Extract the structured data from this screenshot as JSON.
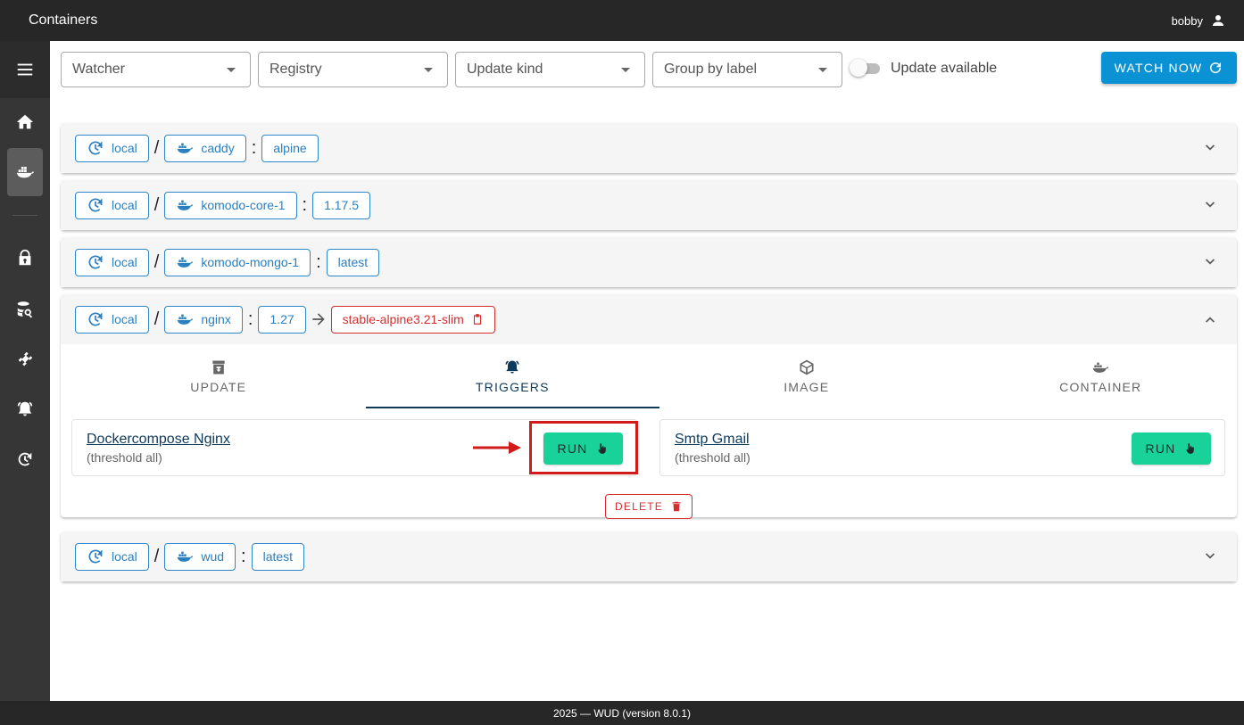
{
  "app": {
    "title": "Containers",
    "user": "bobby"
  },
  "filters": {
    "watcher": "Watcher",
    "registry": "Registry",
    "update_kind": "Update kind",
    "group_by": "Group by label",
    "update_available_label": "Update available",
    "update_available_on": false,
    "watch_now_label": "WATCH NOW"
  },
  "containers": [
    {
      "watcher": "local",
      "name": "caddy",
      "tag": "alpine"
    },
    {
      "watcher": "local",
      "name": "komodo-core-1",
      "tag": "1.17.5"
    },
    {
      "watcher": "local",
      "name": "komodo-mongo-1",
      "tag": "latest"
    },
    {
      "watcher": "local",
      "name": "nginx",
      "tag": "1.27",
      "new_tag": "stable-alpine3.21-slim"
    },
    {
      "watcher": "local",
      "name": "wud",
      "tag": "latest"
    }
  ],
  "tabs": [
    {
      "label": "UPDATE",
      "icon": "archive-icon"
    },
    {
      "label": "TRIGGERS",
      "icon": "bell-icon"
    },
    {
      "label": "IMAGE",
      "icon": "cube-icon"
    },
    {
      "label": "CONTAINER",
      "icon": "docker-icon"
    }
  ],
  "triggers": [
    {
      "name": "Dockercompose Nginx",
      "threshold": "(threshold all)",
      "run_label": "RUN"
    },
    {
      "name": "Smtp Gmail",
      "threshold": "(threshold all)",
      "run_label": "RUN"
    }
  ],
  "delete_label": "DELETE",
  "footer": "2025 — WUD (version 8.0.1)",
  "colors": {
    "accent": "#0b92d4",
    "run": "#19d29a",
    "danger": "#d32f2f",
    "chip": "#2a7fc0"
  }
}
